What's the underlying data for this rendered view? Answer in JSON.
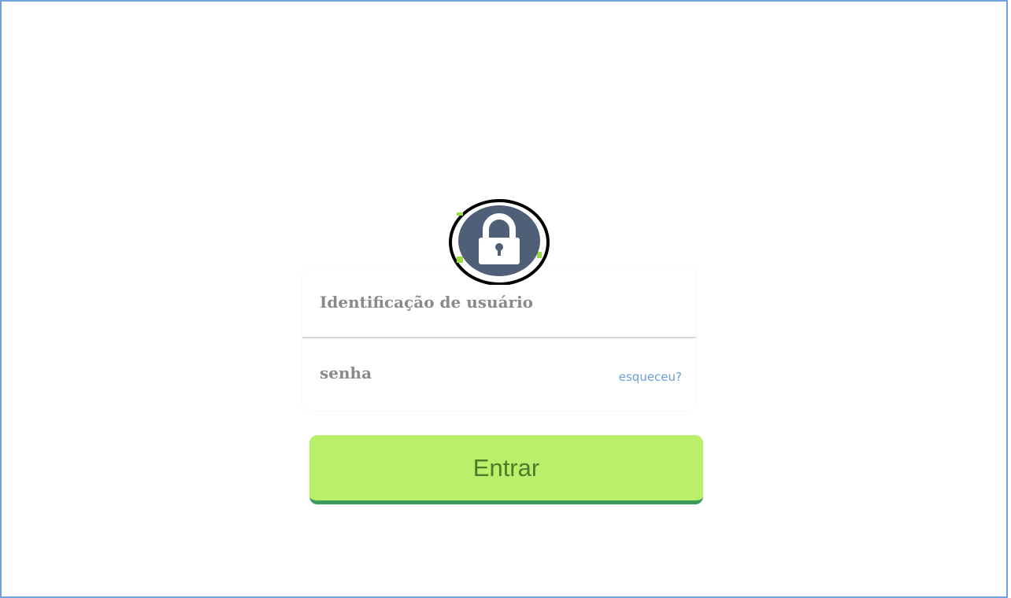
{
  "login": {
    "username_placeholder": "Identificação de usuário",
    "password_placeholder": "senha",
    "forgot_label": "esqueceu?",
    "submit_label": "Entrar"
  },
  "icons": {
    "lock": "lock-icon"
  },
  "colors": {
    "frame_border": "#6fa3de",
    "button_bg": "#b9ef6a",
    "button_border": "#3c9a5c",
    "button_text": "#4f7a2a",
    "link": "#6a9fd6",
    "lock_badge": "#4f5f78"
  }
}
